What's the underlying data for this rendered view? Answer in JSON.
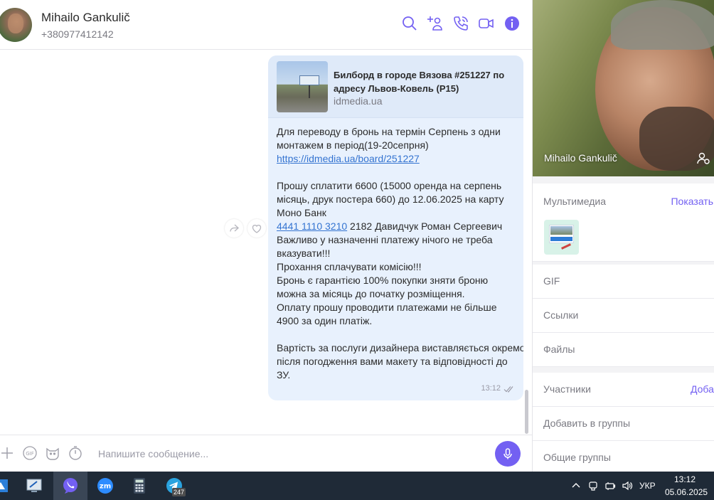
{
  "contact": {
    "name": "Mihailo Gankulič",
    "phone": "+380977412142"
  },
  "message": {
    "preview_title": "Билборд в городе Вязова #251227 по адресу Львов-Ковель (Р15)",
    "preview_domain": "idmedia.ua",
    "lines": {
      "l1": "Для переводу в бронь на термін Серпень з одни",
      "l2": "монтажем в період(19-20сепрня)",
      "l3": "https://idmedia.ua/board/251227",
      "l4": "Прошу сплатити 6600 (15000 оренда на серпень",
      "l5": "місяць, друк постера 660) до 12.06.2025  на карту",
      "l6": "Моно Банк",
      "l7_link": "4441 1110 3210",
      "l7_rest": " 2182 Давидчук Роман Сергеевич",
      "l8": "Важливо у назначенні платежу нічого не треба",
      "l9": "вказувати!!!",
      "l10": "Прохання сплачувати комісію!!!",
      "l11": "Бронь є гарантією 100% покупки зняти броню",
      "l12": "можна за місяць до початку розміщення.",
      "l13": "Оплату прошу проводити платежами не більше",
      "l14": "4900 за один платіж.",
      "l15": "Вартість за послуги дизайнера виставляється окремо",
      "l16": "після погодження вами макету та відповідності до",
      "l17": "ЗУ."
    },
    "time": "13:12"
  },
  "composer": {
    "placeholder": "Напишите сообщение..."
  },
  "panel": {
    "photo_name": "Mihailo Gankulič",
    "multimedia_label": "Мультимедиа",
    "multimedia_action": "Показать",
    "gif_label": "GIF",
    "links_label": "Ссылки",
    "files_label": "Файлы",
    "participants_label": "Участники",
    "participants_action": "Добавить",
    "add_to_groups_label": "Добавить в группы",
    "common_groups_label": "Общие группы"
  },
  "taskbar": {
    "telegram_badge": "247",
    "language": "УКР",
    "time": "13:12",
    "date": "05.06.2025"
  },
  "colors": {
    "accent": "#7360f2",
    "bubble": "#e8f1fd",
    "link": "#3474d1",
    "taskbar": "#1f2a37"
  }
}
